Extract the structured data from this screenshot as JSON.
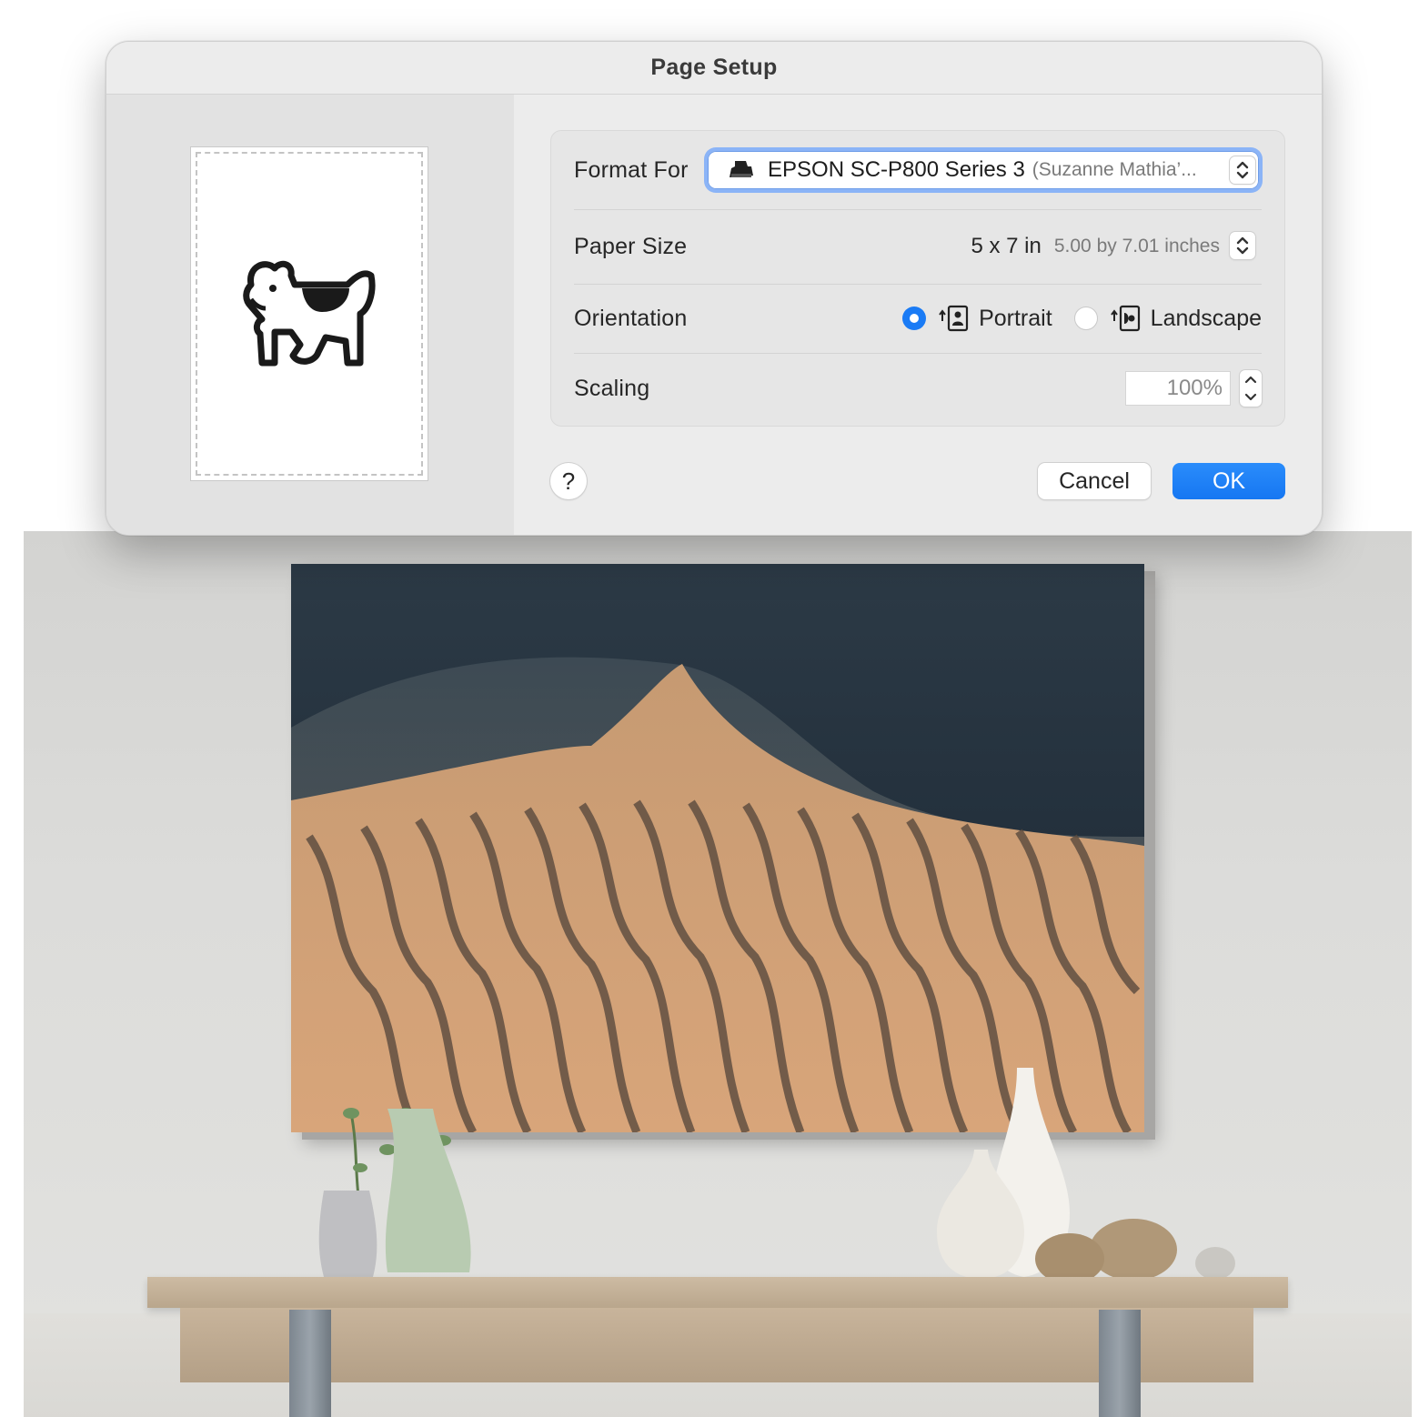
{
  "dialog": {
    "title": "Page Setup"
  },
  "format_for": {
    "label": "Format For",
    "printer_name": "EPSON SC-P800 Series 3",
    "printer_owner": "(Suzanne Mathia’...",
    "icon": "printer-icon"
  },
  "paper_size": {
    "label": "Paper Size",
    "value": "5 x 7 in",
    "detail": "5.00 by 7.01 inches"
  },
  "orientation": {
    "label": "Orientation",
    "selected": "Portrait",
    "options": [
      {
        "label": "Portrait",
        "icon": "portrait-orientation-icon",
        "selected": true
      },
      {
        "label": "Landscape",
        "icon": "landscape-orientation-icon",
        "selected": false
      }
    ]
  },
  "scaling": {
    "label": "Scaling",
    "value": "100%"
  },
  "buttons": {
    "help": "?",
    "cancel": "Cancel",
    "ok": "OK"
  },
  "preview": {
    "icon": "dogcow-icon"
  },
  "colors": {
    "accent": "#1a7bf5",
    "focus_ring": "#8bb4f7",
    "dialog_bg": "#ececec"
  }
}
